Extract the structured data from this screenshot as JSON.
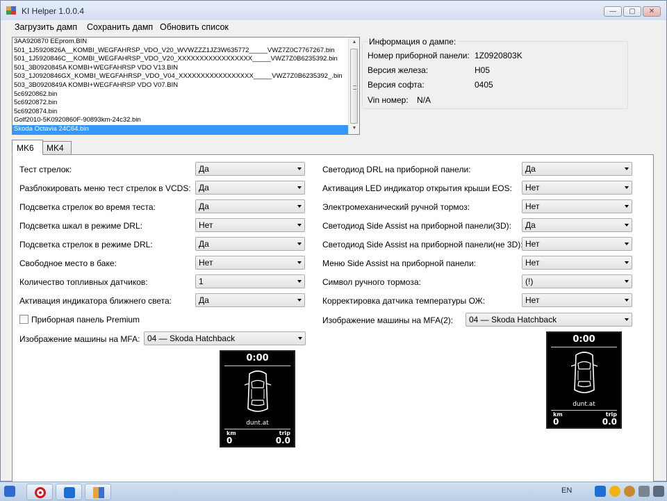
{
  "window": {
    "title": "KI Helper 1.0.0.4",
    "controls": {
      "minimize": "—",
      "maximize": "▢",
      "close": "✕"
    }
  },
  "menu": {
    "load": "Загрузить дамп",
    "save": "Сохранить дамп",
    "refresh": "Обновить список"
  },
  "files": [
    "3AA920870 EEprom.BIN",
    "501_1J5920826A__KOMBI_WEGFAHRSP_VDO_V20_WVWZZZ1JZ3W635772_____VWZ7Z0C7767267.bin",
    "501_1J5920846C__KOMBI_WEGFAHRSP_VDO_V20_XXXXXXXXXXXXXXXXX_____VWZ7Z0B6235392.bin",
    "501_3B0920845A  KOMBI+WEGFAHRSP VDO V13.BIN",
    "503_1J0920846GX_KOMBI_WEGFAHRSP_VDO_V04_XXXXXXXXXXXXXXXXX_____VWZ7Z0B6235392_.bin",
    "503_3B0920849A  KOMBI+WEGFAHRSP VDO V07.BIN",
    "5c6920862.bin",
    "5c6920872.bin",
    "5c6920874.bin",
    "Golf2010-5K0920860F-90893km-24c32.bin",
    "Skoda Octavia  24C64.bin"
  ],
  "selected_file": "Skoda Octavia  24C64.bin",
  "info": {
    "legend": "Информация о дампе:",
    "panel_label": "Номер приборной панели:",
    "panel_value": "1Z0920803K",
    "hw_label": "Версия железа:",
    "hw_value": "H05",
    "sw_label": "Версия софта:",
    "sw_value": "0405",
    "vin_label": "Vin номер:",
    "vin_value": "N/A"
  },
  "tabs": {
    "active": "MK6",
    "other": "MK4"
  },
  "left_settings": [
    {
      "label": "Тест стрелок:",
      "value": "Да"
    },
    {
      "label": "Разблокировать меню тест стрелок в VCDS:",
      "value": "Да"
    },
    {
      "label": "Подсветка стрелок во время теста:",
      "value": "Да"
    },
    {
      "label": "Подсветка шкал в режиме DRL:",
      "value": "Нет"
    },
    {
      "label": "Подсветка стрелок в режиме DRL:",
      "value": "Да"
    },
    {
      "label": "Свободное место в баке:",
      "value": "Нет"
    },
    {
      "label": "Количество топливных датчиков:",
      "value": "1"
    },
    {
      "label": "Активация индикатора ближнего света:",
      "value": "Да"
    }
  ],
  "right_settings": [
    {
      "label": "Светодиод DRL на приборной панели:",
      "value": "Да"
    },
    {
      "label": "Активация LED индикатор открытия крыши EOS:",
      "value": "Нет"
    },
    {
      "label": "Электромеханический ручной тормоз:",
      "value": "Нет"
    },
    {
      "label": "Светодиод Side Assist на приборной панели(3D):",
      "value": "Да"
    },
    {
      "label": "Светодиод Side Assist на приборной панели(не 3D):",
      "value": "Нет"
    },
    {
      "label": "Меню Side Assist на приборной панели:",
      "value": "Нет"
    },
    {
      "label": "Символ ручного тормоза:",
      "value": "(!)"
    },
    {
      "label": "Корректировка датчика температуры ОЖ:",
      "value": "Нет"
    }
  ],
  "premium": {
    "label": "Приборная панель Premium",
    "checked": false
  },
  "mfa_left": {
    "label": "Изображение машины на MFA:",
    "value": "04 — Skoda Hatchback"
  },
  "mfa_right": {
    "label": "Изображение машины на MFA(2):",
    "value": "04 — Skoda Hatchback"
  },
  "mfa_display": {
    "time": "0:00",
    "site": "dunt.at",
    "km_label": "km",
    "trip_label": "trip",
    "km_value": "0",
    "trip_value": "0.0"
  },
  "taskbar": {
    "lang": "EN"
  },
  "colors": {
    "selection": "#3399ff",
    "titlebar": "#d3def0",
    "panel": "#f0f0f0"
  }
}
